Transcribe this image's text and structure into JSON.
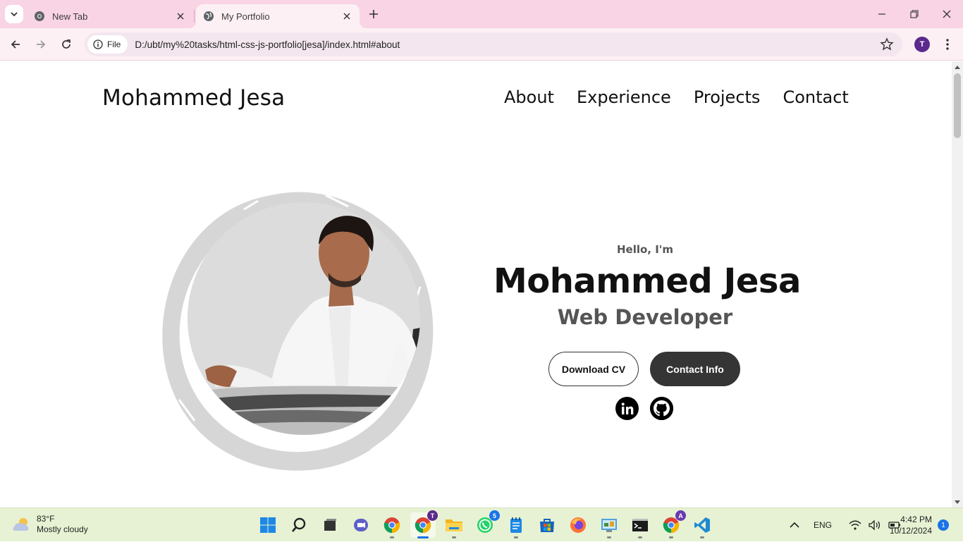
{
  "browser": {
    "tabs": [
      {
        "title": "New Tab",
        "icon": "chrome-icon"
      },
      {
        "title": "My Portfolio",
        "icon": "globe-icon"
      }
    ],
    "address": {
      "chip_label": "File",
      "url": "D:/ubt/my%20tasks/html-css-js-portfolio[jesa]/index.html#about"
    },
    "profile_initial": "T"
  },
  "page": {
    "logo": "Mohammed Jesa",
    "nav": [
      "About",
      "Experience",
      "Projects",
      "Contact"
    ],
    "hero": {
      "greeting": "Hello, I'm",
      "name": "Mohammed Jesa",
      "role": "Web Developer",
      "buttons": {
        "download_cv": "Download CV",
        "contact_info": "Contact Info"
      },
      "socials": [
        "linkedin-icon",
        "github-icon"
      ]
    }
  },
  "taskbar": {
    "weather": {
      "temp": "83°F",
      "condition": "Mostly cloudy"
    },
    "apps": [
      "windows-start",
      "search",
      "task-view",
      "meet",
      "chrome",
      "chrome-profile",
      "file-explorer",
      "whatsapp",
      "notepad",
      "microsoft-store",
      "firefox",
      "control-panel",
      "terminal",
      "chrome-profile-a",
      "vscode"
    ],
    "badges": {
      "chrome_profile": "T",
      "whatsapp": "5",
      "chrome_profile_a": "A"
    },
    "tray": {
      "language": "ENG"
    },
    "clock": {
      "time": "4:42 PM",
      "date": "10/12/2024"
    },
    "notifications": "1"
  },
  "colors": {
    "tabstrip": "#f9d4e4",
    "toolbar": "#fdf0f4",
    "taskbar": "#e6f2d3",
    "button_dark": "#353535",
    "profile": "#5b2a8c"
  }
}
